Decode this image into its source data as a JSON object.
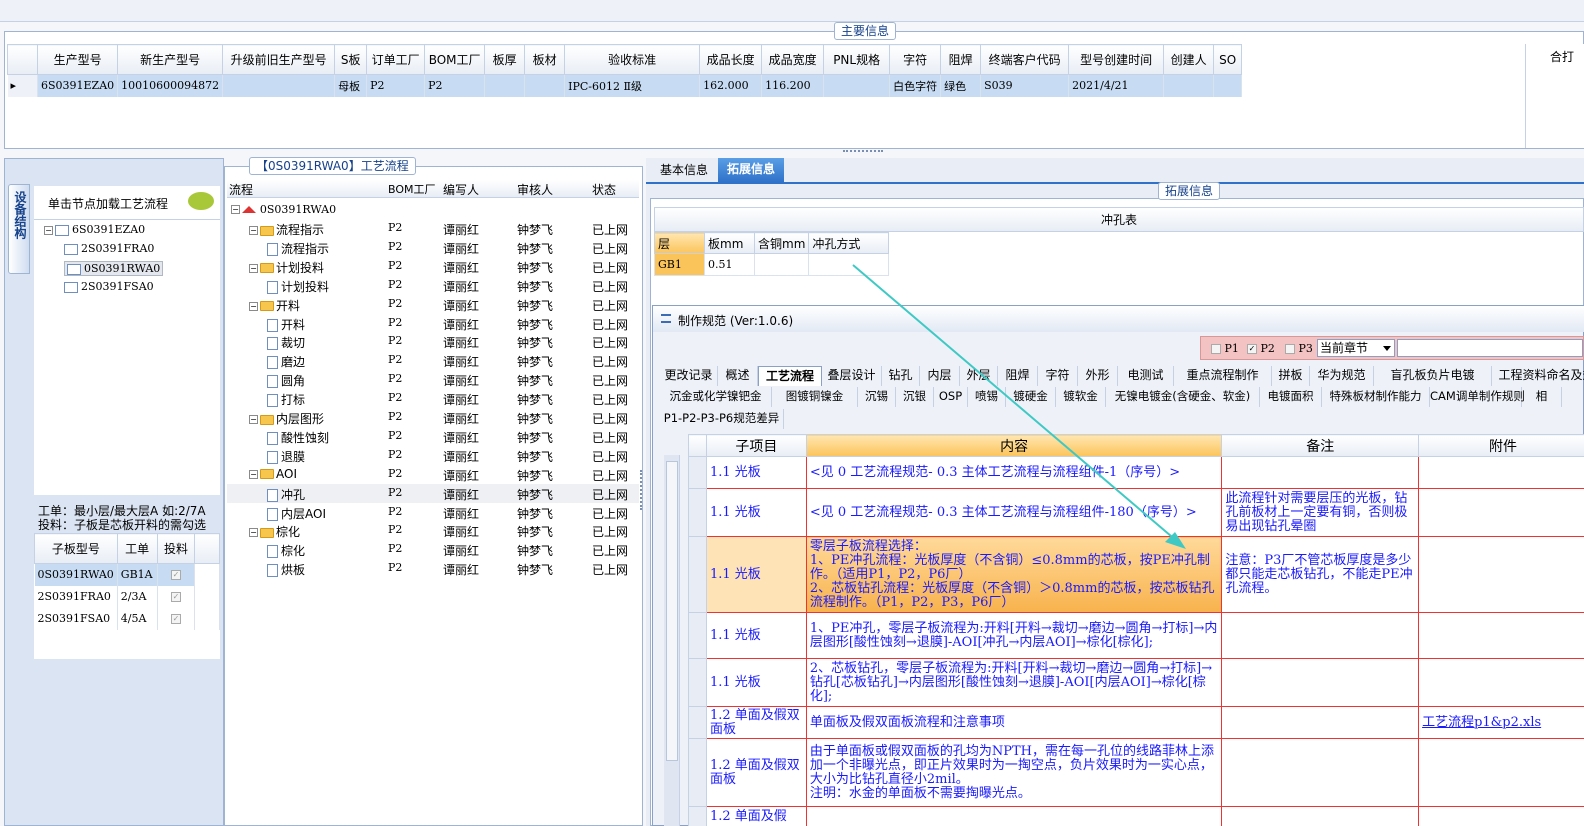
{
  "top_group_title": "主要信息",
  "main_grid": {
    "headers": [
      "生产型号",
      "新生产型号",
      "升级前旧生产型号",
      "S板",
      "订单工厂",
      "BOM工厂",
      "板厚",
      "板材",
      "验收标准",
      "成品长度",
      "成品宽度",
      "PNL规格",
      "字符",
      "阻焊",
      "终端客户代码",
      "型号创建时间",
      "创建人",
      "SO"
    ],
    "row": [
      "6S0391EZA0",
      "10010600094872",
      "",
      "母板",
      "P2",
      "P2",
      "",
      "",
      "IPC-6012 Ⅱ级",
      "162.000",
      "116.200",
      "",
      "白色字符",
      "绿色",
      "S039",
      "2021/4/21",
      "",
      ""
    ]
  },
  "right_stub": "合打",
  "left_vtab": "设备结构",
  "left_hint": "单击节点加载工艺流程",
  "left_tree": [
    "6S0391EZA0",
    "2S0391FRA0",
    "0S0391RWA0",
    "2S0391FSA0"
  ],
  "left_note1": "工单：最小层/最大层A 如:2/7A",
  "left_note2": "投料：子板是芯板开料的需勾选",
  "sub_grid": {
    "headers": [
      "子板型号",
      "工单",
      "投料"
    ],
    "rows": [
      [
        "0S0391RWA0",
        "GB1A"
      ],
      [
        "2S0391FRA0",
        "2/3A"
      ],
      [
        "2S0391FSA0",
        "4/5A"
      ]
    ]
  },
  "flow_title": "【0S0391RWA0】工艺流程",
  "flow_headers": [
    "流程",
    "BOM工厂",
    "编写人",
    "审核人",
    "状态"
  ],
  "flow_root": "0S0391RWA0",
  "flow_rows": [
    {
      "name": "流程指示",
      "f": "P2",
      "w": "谭丽红",
      "r": "钟梦飞",
      "s": "已上网",
      "lvl": 1
    },
    {
      "name": "流程指示",
      "f": "P2",
      "w": "谭丽红",
      "r": "钟梦飞",
      "s": "已上网",
      "lvl": 2
    },
    {
      "name": "计划投料",
      "f": "P2",
      "w": "谭丽红",
      "r": "钟梦飞",
      "s": "已上网",
      "lvl": 1
    },
    {
      "name": "计划投料",
      "f": "P2",
      "w": "谭丽红",
      "r": "钟梦飞",
      "s": "已上网",
      "lvl": 2
    },
    {
      "name": "开料",
      "f": "P2",
      "w": "谭丽红",
      "r": "钟梦飞",
      "s": "已上网",
      "lvl": 1
    },
    {
      "name": "开料",
      "f": "P2",
      "w": "谭丽红",
      "r": "钟梦飞",
      "s": "已上网",
      "lvl": 2
    },
    {
      "name": "裁切",
      "f": "P2",
      "w": "谭丽红",
      "r": "钟梦飞",
      "s": "已上网",
      "lvl": 2
    },
    {
      "name": "磨边",
      "f": "P2",
      "w": "谭丽红",
      "r": "钟梦飞",
      "s": "已上网",
      "lvl": 2
    },
    {
      "name": "圆角",
      "f": "P2",
      "w": "谭丽红",
      "r": "钟梦飞",
      "s": "已上网",
      "lvl": 2
    },
    {
      "name": "打标",
      "f": "P2",
      "w": "谭丽红",
      "r": "钟梦飞",
      "s": "已上网",
      "lvl": 2
    },
    {
      "name": "内层图形",
      "f": "P2",
      "w": "谭丽红",
      "r": "钟梦飞",
      "s": "已上网",
      "lvl": 1
    },
    {
      "name": "酸性蚀刻",
      "f": "P2",
      "w": "谭丽红",
      "r": "钟梦飞",
      "s": "已上网",
      "lvl": 2
    },
    {
      "name": "退膜",
      "f": "P2",
      "w": "谭丽红",
      "r": "钟梦飞",
      "s": "已上网",
      "lvl": 2
    },
    {
      "name": "AOI",
      "f": "P2",
      "w": "谭丽红",
      "r": "钟梦飞",
      "s": "已上网",
      "lvl": 1
    },
    {
      "name": "冲孔",
      "f": "P2",
      "w": "谭丽红",
      "r": "钟梦飞",
      "s": "已上网",
      "lvl": 2
    },
    {
      "name": "内层AOI",
      "f": "P2",
      "w": "谭丽红",
      "r": "钟梦飞",
      "s": "已上网",
      "lvl": 2
    },
    {
      "name": "棕化",
      "f": "P2",
      "w": "谭丽红",
      "r": "钟梦飞",
      "s": "已上网",
      "lvl": 1
    },
    {
      "name": "棕化",
      "f": "P2",
      "w": "谭丽红",
      "r": "钟梦飞",
      "s": "已上网",
      "lvl": 2
    },
    {
      "name": "烘板",
      "f": "P2",
      "w": "谭丽红",
      "r": "钟梦飞",
      "s": "已上网",
      "lvl": 2
    }
  ],
  "right_tabs": [
    "基本信息",
    "拓展信息"
  ],
  "ext_group_title": "拓展信息",
  "punch_title": "冲孔表",
  "punch_headers": [
    "层",
    "板mm",
    "含铜mm",
    "冲孔方式"
  ],
  "punch_row": [
    "GB1",
    "0.51",
    "",
    ""
  ],
  "dialog_title": "制作规范 (Ver:1.0.6)",
  "filter": {
    "p1": "P1",
    "p2": "P2",
    "p3": "P3",
    "select": "当前章节"
  },
  "tabs_row1": [
    "更改记录",
    "概述",
    "工艺流程",
    "叠层设计",
    "钻孔",
    "内层",
    "外层",
    "阻焊",
    "字符",
    "外形",
    "电测试",
    "重点流程制作",
    "拼板",
    "华为规范",
    "盲孔板负片电镀",
    "工程资料命名及规"
  ],
  "tabs_row2": [
    "沉金或化学镍钯金",
    "图镀铜镍金",
    "沉锡",
    "沉银",
    "OSP",
    "喷锡",
    "镀硬金",
    "镀软金",
    "无镍电镀金(含硬金、软金)",
    "电镀面积",
    "特殊板材制作能力",
    "CAM调单制作规则",
    "相"
  ],
  "tabs_row3": [
    "P1-P2-P3-P6规范差异"
  ],
  "spec_headers": [
    "子项目",
    "内容",
    "备注",
    "附件"
  ],
  "spec_rows": [
    {
      "sub": "1.1 光板",
      "content": "<见 0 工艺流程规范- 0.3 主体工艺流程与流程组件-1（序号）>",
      "note": "",
      "att": ""
    },
    {
      "sub": "1.1 光板",
      "content": "<见 0 工艺流程规范- 0.3 主体工艺流程与流程组件-180（序号）>",
      "note": "此流程针对需要层压的光板，钻孔前板材上一定要有铜，否则极易出现钻孔晕圈",
      "att": ""
    },
    {
      "sub": "1.1 光板",
      "content": "零层子板流程选择：\n1、PE冲孔流程：光板厚度（不含铜）≤0.8mm的芯板，按PE冲孔制作。（适用P1，P2，P6厂）\n2、芯板钻孔流程：光板厚度（不含铜）＞0.8mm的芯板，按芯板钻孔流程制作。（P1，P2，P3，P6厂）",
      "note": "注意：P3厂不管芯板厚度是多少都只能走芯板钻孔，不能走PE冲孔流程。",
      "att": ""
    },
    {
      "sub": "1.1 光板",
      "content": "1、PE冲孔，零层子板流程为:开料[开料→裁切→磨边→圆角→打标]→内层图形[酸性蚀刻→退膜]-AOI[冲孔→内层AOI]→棕化[棕化];",
      "note": "",
      "att": ""
    },
    {
      "sub": "1.1 光板",
      "content": "2、芯板钻孔，零层子板流程为:开料[开料→裁切→磨边→圆角→打标]→钻孔[芯板钻孔]→内层图形[酸性蚀刻→退膜]-AOI[内层AOI]→棕化[棕化];",
      "note": "",
      "att": ""
    },
    {
      "sub": "1.2 单面及假双面板",
      "content": "单面板及假双面板流程和注意事项",
      "note": "",
      "att": "工艺流程p1&p2.xls"
    },
    {
      "sub": "1.2 单面及假双面板",
      "content": "由于单面板或假双面板的孔均为NPTH，需在每一孔位的线路菲林上添加一个非曝光点，即正片效果时为一掏空点，负片效果时为一实心点，大小为比钻孔直径小2mil。\n注明：水金的单面板不需要掏曝光点。",
      "note": "",
      "att": ""
    },
    {
      "sub": "1.2 单面及假",
      "content": "",
      "note": "",
      "att": ""
    }
  ]
}
